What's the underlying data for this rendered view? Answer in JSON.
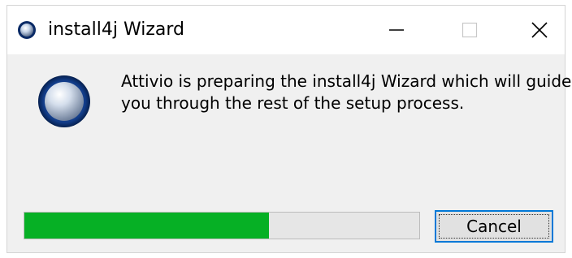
{
  "window": {
    "title": "install4j Wizard",
    "icon": "install4j-sphere-icon"
  },
  "controls": {
    "minimize_icon": "minimize-icon",
    "maximize_icon": "maximize-icon",
    "close_icon": "close-icon"
  },
  "content": {
    "icon": "install4j-sphere-icon",
    "message_line1": "Attivio is preparing the install4j Wizard which will guide",
    "message_line2": "you through the rest of the setup process."
  },
  "progress": {
    "value": 0.62,
    "fill_color": "#06b025"
  },
  "buttons": {
    "cancel_label": "Cancel"
  },
  "colors": {
    "accent": "#0078d7",
    "progress": "#06b025"
  }
}
